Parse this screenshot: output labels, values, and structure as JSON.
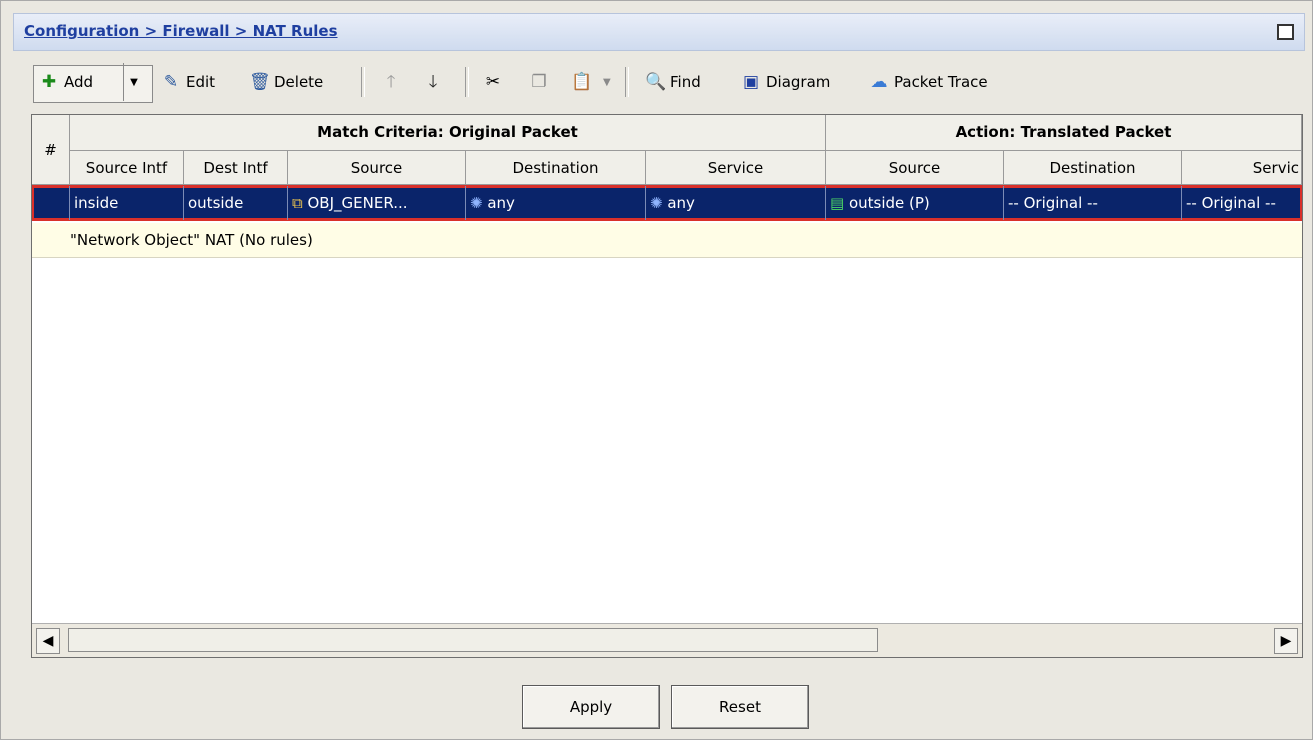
{
  "breadcrumb": "Configuration > Firewall > NAT Rules",
  "toolbar": {
    "add": "Add",
    "edit": "Edit",
    "delete": "Delete",
    "find": "Find",
    "diagram": "Diagram",
    "packet_trace": "Packet Trace"
  },
  "table": {
    "num_header": "#",
    "group_match": "Match Criteria: Original Packet",
    "group_action": "Action: Translated Packet",
    "columns": [
      "Source Intf",
      "Dest Intf",
      "Source",
      "Destination",
      "Service",
      "Source",
      "Destination",
      "Servic"
    ],
    "selected_row": {
      "source_intf": "inside",
      "dest_intf": "outside",
      "source": "OBJ_GENER...",
      "destination": "any",
      "service": "any",
      "t_source": "outside (P)",
      "t_destination": "-- Original --",
      "t_service": "-- Original --"
    },
    "info_row": "\"Network Object\" NAT (No rules)"
  },
  "buttons": {
    "apply": "Apply",
    "reset": "Reset"
  },
  "colors": {
    "selection": "#0a246a",
    "highlight_border": "#d9302a",
    "breadcrumb_link": "#1f3fa0"
  }
}
